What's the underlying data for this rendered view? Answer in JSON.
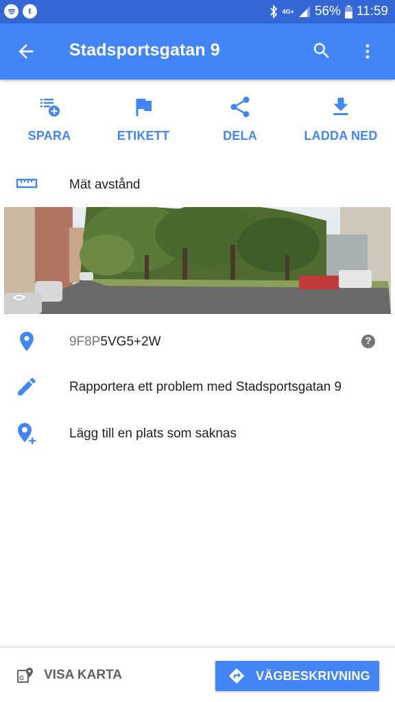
{
  "status_bar": {
    "battery": "56%",
    "time": "11:59",
    "network": "4G+"
  },
  "app_bar": {
    "title": "Stadsportsgatan 9",
    "icons": [
      "back-arrow-icon",
      "search-icon",
      "more-vert-icon"
    ]
  },
  "actions": [
    {
      "label": "SPARA",
      "icon": "playlist-add-icon"
    },
    {
      "label": "ETIKETT",
      "icon": "flag-icon"
    },
    {
      "label": "DELA",
      "icon": "share-icon"
    },
    {
      "label": "LADDA NED",
      "icon": "download-icon"
    }
  ],
  "measure": {
    "label": "Mät avstånd",
    "icon": "ruler-icon"
  },
  "plus_code": {
    "area": "9F8P",
    "code": "5VG5+2W"
  },
  "report": {
    "label": "Rapportera ett problem med Stadsportsgatan 9"
  },
  "add_place": {
    "label": "Lägg till en plats som saknas"
  },
  "bottom": {
    "map_label": "VISA KARTA",
    "directions_label": "VÄGBESKRIVNING"
  },
  "colors": {
    "status_bar": "#3367d6",
    "app_bar": "#4285f4",
    "accent": "#4285f4",
    "text": "#212121",
    "secondary": "#757575"
  }
}
